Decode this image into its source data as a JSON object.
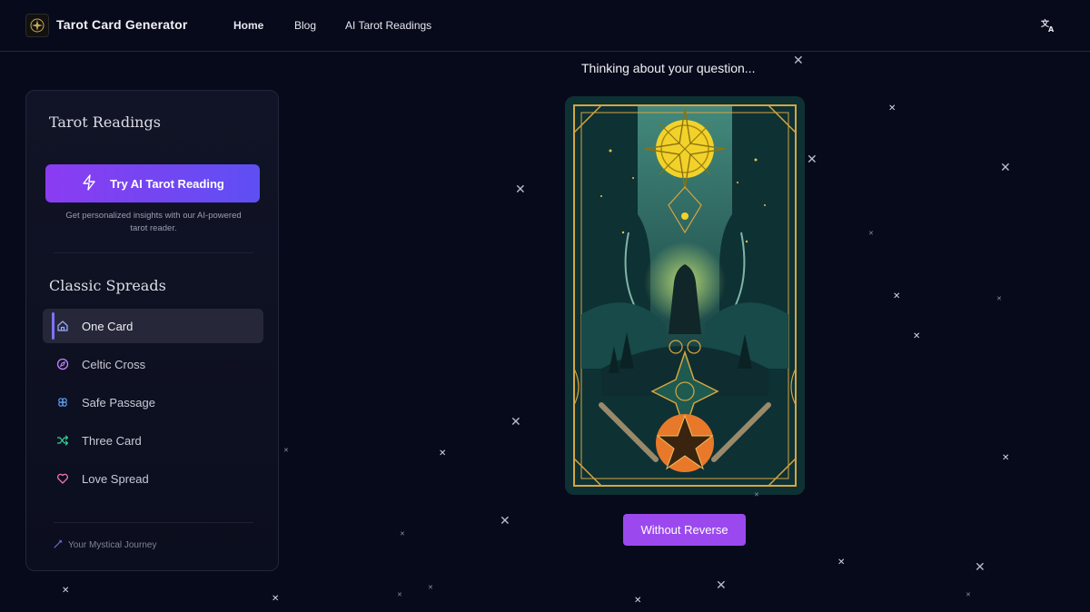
{
  "header": {
    "brand": "Tarot Card Generator",
    "nav": [
      "Home",
      "Blog",
      "AI Tarot Readings"
    ],
    "language_icon": "translate-icon"
  },
  "sidebar": {
    "heading": "Tarot Readings",
    "ai_button": "Try AI Tarot Reading",
    "ai_description": "Get personalized insights with our AI-powered tarot reader.",
    "spreads_heading": "Classic Spreads",
    "spreads": [
      {
        "label": "One Card",
        "icon": "home-icon",
        "color": "#9aa8ff",
        "active": true
      },
      {
        "label": "Celtic Cross",
        "icon": "compass-icon",
        "color": "#c084fc",
        "active": false
      },
      {
        "label": "Safe Passage",
        "icon": "clover-icon",
        "color": "#60a5fa",
        "active": false
      },
      {
        "label": "Three Card",
        "icon": "shuffle-icon",
        "color": "#34d399",
        "active": false
      },
      {
        "label": "Love Spread",
        "icon": "heart-icon",
        "color": "#f472b6",
        "active": false
      }
    ],
    "footer": "Your Mystical Journey"
  },
  "main": {
    "status": "Thinking about your question...",
    "reverse_button": "Without Reverse"
  },
  "colors": {
    "background": "#070a1b",
    "accent": "#9b49ef",
    "gradient_start": "#8b3cf2",
    "gradient_end": "#5e4ff3"
  }
}
